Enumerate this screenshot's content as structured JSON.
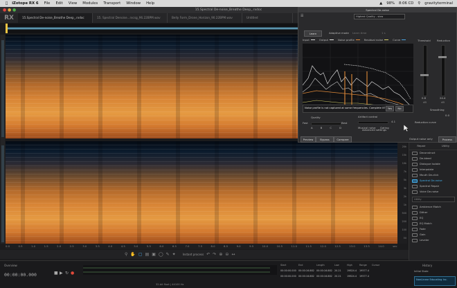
{
  "menubar": {
    "app": "iZotope RX 6",
    "items": [
      "File",
      "Edit",
      "View",
      "Modules",
      "Transport",
      "Window",
      "Help"
    ],
    "status": {
      "battery": "98%",
      "time": "8:06 CD",
      "user": "gravityterminal"
    }
  },
  "window": {
    "title": "15.Spectral De-noise_Breathe Deep_.rxdoc"
  },
  "app_logo": "RX",
  "tabs": [
    {
      "label": "15.Spectral De-noise_Breathe Deep_.rxdoc",
      "active": true
    },
    {
      "label": "15. Spectral Denoise...rxcsg_96.22BPM.wav",
      "active": false
    },
    {
      "label": "Belly Form_Drone_Horizon_90.22BPM.wav",
      "active": false
    },
    {
      "label": "Untitled",
      "active": false
    }
  ],
  "module": {
    "title": "Spectral De-noise",
    "preset": "Highest Quality - slow",
    "learn_button": "Learn",
    "adaptive_mode_label": "Adaptive mode",
    "learn_time_label": "Learn time",
    "learn_time_value": "1 s",
    "legend": [
      "Input",
      "Output",
      "Noise profile",
      "Residual noise",
      "Curve"
    ],
    "legend_colors": [
      "#d9d9d9",
      "#e6e6e6",
      "#e08a3a",
      "#d9d36a",
      "#4aa3df"
    ],
    "threshold_label": "Threshold",
    "reduction_label": "Reduction",
    "threshold_value": "0.8",
    "reduction_value": "24.4",
    "db_unit": "dB",
    "warning": "Noise profile is not captured at some frequencies. Complete it?",
    "yes_button": "Yes",
    "no_button": "No",
    "quality_label": "Quality",
    "quality_options": [
      "A",
      "B",
      "C",
      "D"
    ],
    "fast_label": "Fast",
    "best_label": "Best",
    "artifact_label": "Artifact control",
    "artifact_value": "4.1",
    "musical_noise_label": "Musical noise",
    "gating_label": "Gating",
    "smoothing_label": "Smoothing",
    "smoothing_value": "0.0",
    "reduction_curve_label": "Reduction curve",
    "advanced_label": "Advanced settings",
    "preview_button": "Preview",
    "bypass_button": "Bypass",
    "compare_button": "Compare",
    "output_noise_label": "Output noise only",
    "process_button": "Process"
  },
  "module_list": {
    "tabs": [
      "Repair",
      "Utility"
    ],
    "filter_placeholder": "Utility",
    "items": [
      {
        "label": "Deconstruct",
        "selected": false
      },
      {
        "label": "De-bleed",
        "selected": false
      },
      {
        "label": "Dialogue Isolate",
        "selected": false
      },
      {
        "label": "Interpolate",
        "selected": false
      },
      {
        "label": "Mouth De-click",
        "selected": false
      },
      {
        "label": "Spectral De-noise",
        "selected": true
      },
      {
        "label": "Spectral Repair",
        "selected": false
      },
      {
        "label": "Voice De-noise",
        "selected": false
      },
      {
        "label": "Ambience Match",
        "selected": false
      },
      {
        "label": "Dither",
        "selected": false
      },
      {
        "label": "EQ",
        "selected": false
      },
      {
        "label": "EQ Match",
        "selected": false
      },
      {
        "label": "Fade",
        "selected": false
      },
      {
        "label": "Gain",
        "selected": false
      },
      {
        "label": "Leveler",
        "selected": false
      }
    ]
  },
  "timeline": {
    "ticks": [
      "0.0",
      "0.5",
      "1.0",
      "1.5",
      "2.0",
      "2.5",
      "3.0",
      "3.5",
      "4.0",
      "4.5",
      "5.0",
      "5.5",
      "6.0",
      "6.5",
      "7.0",
      "7.5",
      "8.0",
      "8.5",
      "9.0",
      "9.5",
      "10.0",
      "10.5",
      "11.0",
      "11.5",
      "12.0",
      "12.5",
      "13.0",
      "13.5",
      "14.0"
    ],
    "unit": "sec"
  },
  "freq_ticks": [
    "20k",
    "15k",
    "10k",
    "7k",
    "5k",
    "3k",
    "2k",
    "1k",
    "500",
    "200",
    "100",
    "50"
  ],
  "toolbar": {
    "instant_process": "Instant process"
  },
  "transport": {
    "label": "Overview",
    "timecode": "00:00:00.000",
    "format": "32-bit float | 44100 Hz",
    "sel_headers": [
      "Start",
      "End",
      "Length",
      "Low",
      "High",
      "Range",
      "Cursor"
    ],
    "sel_row": [
      "00:00:00.000",
      "00:00:16.882",
      "00:00:16.882",
      "20.21",
      "19824.4",
      "19577.4",
      ""
    ],
    "view_row": [
      "00:00:00.000",
      "00:00:16.882",
      "00:00:16.882",
      "20.21",
      "19824.4",
      "19577.4",
      ""
    ],
    "history_label": "History",
    "initial_state": "Initial State",
    "logo_text": "NonLinear Educating Inc."
  }
}
